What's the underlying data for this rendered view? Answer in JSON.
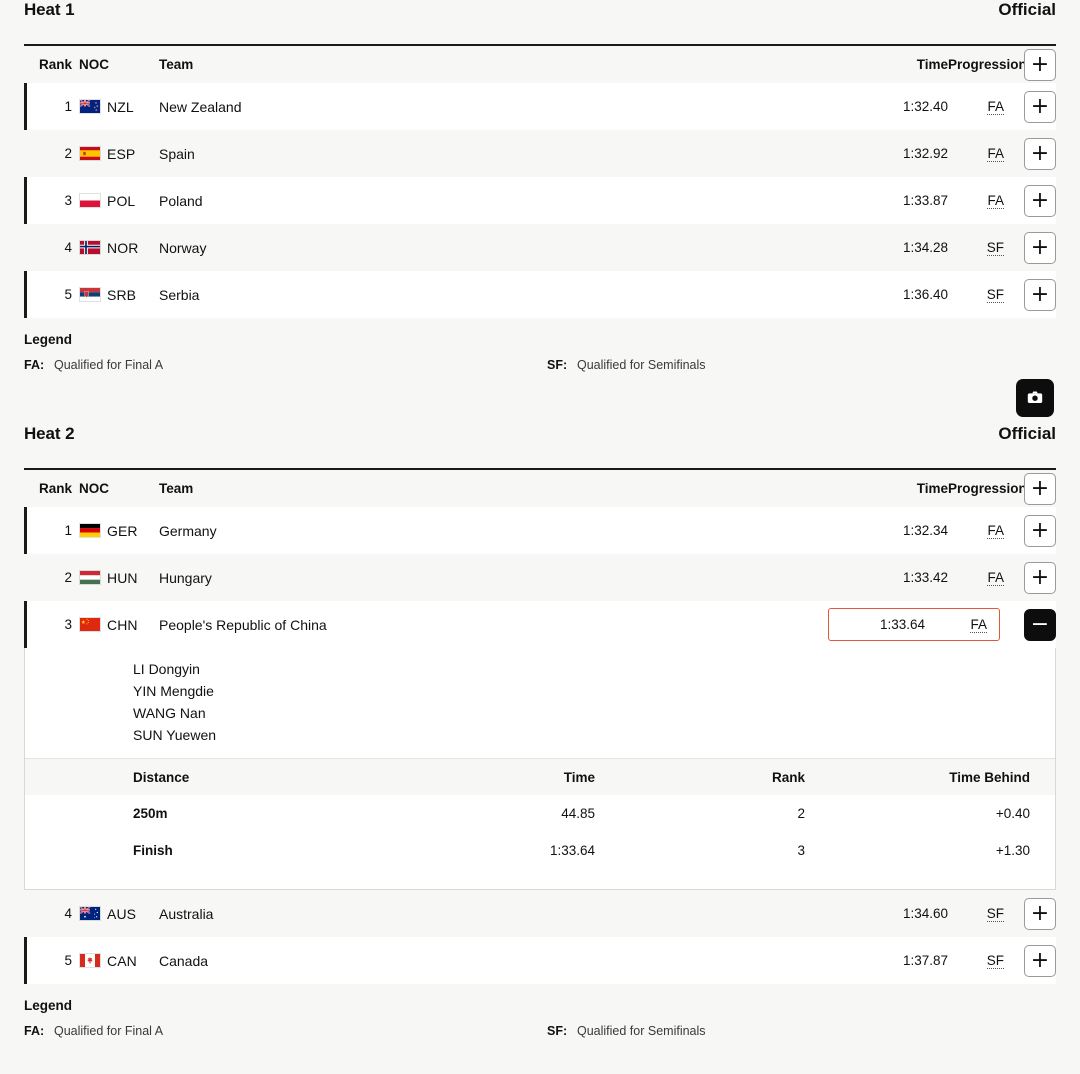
{
  "columns": {
    "rank": "Rank",
    "noc": "NOC",
    "team": "Team",
    "time": "Time",
    "progression": "Progression"
  },
  "splits_columns": {
    "distance": "Distance",
    "time": "Time",
    "rank": "Rank",
    "time_behind": "Time Behind"
  },
  "buttons": {
    "expand": "+",
    "collapse": "−",
    "camera_icon": "camera-icon"
  },
  "legend": {
    "title": "Legend",
    "items": [
      {
        "key": "FA:",
        "desc": "Qualified for Final A"
      },
      {
        "key": "SF:",
        "desc": "Qualified for Semifinals"
      }
    ]
  },
  "heats": [
    {
      "title": "Heat 1",
      "status": "Official",
      "rows": [
        {
          "rank": "1",
          "noc": "NZL",
          "flag": "nzl-flag",
          "team": "New Zealand",
          "time": "1:32.40",
          "progression": "FA"
        },
        {
          "rank": "2",
          "noc": "ESP",
          "flag": "esp-flag",
          "team": "Spain",
          "time": "1:32.92",
          "progression": "FA"
        },
        {
          "rank": "3",
          "noc": "POL",
          "flag": "pol-flag",
          "team": "Poland",
          "time": "1:33.87",
          "progression": "FA"
        },
        {
          "rank": "4",
          "noc": "NOR",
          "flag": "nor-flag",
          "team": "Norway",
          "time": "1:34.28",
          "progression": "SF"
        },
        {
          "rank": "5",
          "noc": "SRB",
          "flag": "srb-flag",
          "team": "Serbia",
          "time": "1:36.40",
          "progression": "SF"
        }
      ]
    },
    {
      "title": "Heat 2",
      "status": "Official",
      "rows": [
        {
          "rank": "1",
          "noc": "GER",
          "flag": "ger-flag",
          "team": "Germany",
          "time": "1:32.34",
          "progression": "FA"
        },
        {
          "rank": "2",
          "noc": "HUN",
          "flag": "hun-flag",
          "team": "Hungary",
          "time": "1:33.42",
          "progression": "FA"
        },
        {
          "rank": "3",
          "noc": "CHN",
          "flag": "chn-flag",
          "team": "People's Republic of China",
          "time": "1:33.64",
          "progression": "FA"
        },
        {
          "rank": "4",
          "noc": "AUS",
          "flag": "aus-flag",
          "team": "Australia",
          "time": "1:34.60",
          "progression": "SF"
        },
        {
          "rank": "5",
          "noc": "CAN",
          "flag": "can-flag",
          "team": "Canada",
          "time": "1:37.87",
          "progression": "SF"
        }
      ]
    }
  ],
  "expanded_detail": {
    "athletes": [
      "LI Dongyin",
      "YIN Mengdie",
      "WANG Nan",
      "SUN Yuewen"
    ],
    "splits": [
      {
        "distance": "250m",
        "time": "44.85",
        "rank": "2",
        "time_behind": "+0.40"
      },
      {
        "distance": "Finish",
        "time": "1:33.64",
        "rank": "3",
        "time_behind": "+1.30"
      }
    ]
  },
  "colors": {
    "accent_selected": "#e0573a",
    "rule": "#1b1b1b",
    "page_bg": "#f7f7f5"
  }
}
